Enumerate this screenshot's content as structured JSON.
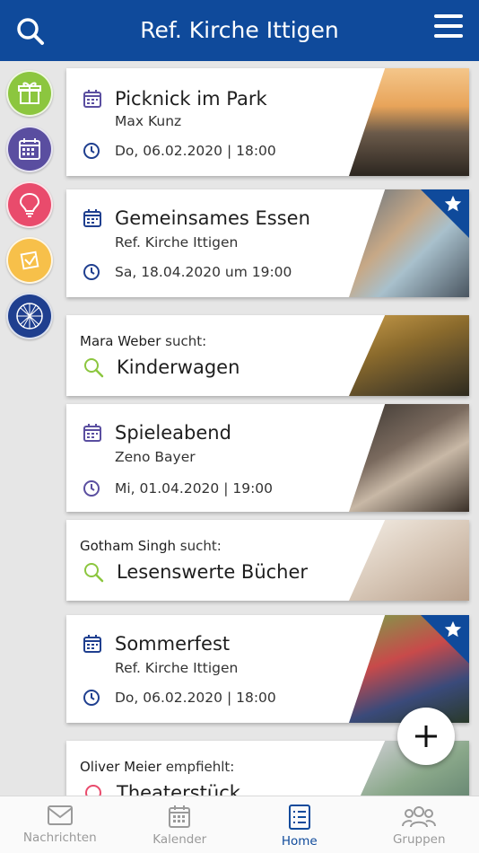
{
  "header": {
    "title": "Ref. Kirche Ittigen",
    "search_icon": "search-icon",
    "menu_icon": "hamburger-menu-icon"
  },
  "rail": [
    {
      "icon": "gift-icon",
      "color": "#8cc63f"
    },
    {
      "icon": "calendar-icon",
      "color": "#5a4ea0"
    },
    {
      "icon": "lightbulb-icon",
      "color": "#e94b6c"
    },
    {
      "icon": "notes-icon",
      "color": "#f7c04a"
    },
    {
      "icon": "network-globe-icon",
      "color": "#1f3f8f"
    }
  ],
  "cards": [
    {
      "type": "event",
      "title": "Picknick im Park",
      "subtitle": "Max Kunz",
      "datetime": "Do, 06.02.2020 | 18:00",
      "favorite": false
    },
    {
      "type": "event",
      "title": "Gemeinsames Essen",
      "subtitle": "Ref. Kirche Ittigen",
      "datetime": "Sa, 18.04.2020 um 19:00",
      "favorite": true
    },
    {
      "type": "search",
      "person": "Mara Weber",
      "verb": "sucht:",
      "title": "Kinderwagen"
    },
    {
      "type": "event",
      "title": "Spieleabend",
      "subtitle": "Zeno Bayer",
      "datetime": "Mi, 01.04.2020 | 19:00",
      "favorite": false
    },
    {
      "type": "search",
      "person": "Gotham Singh",
      "verb": "sucht:",
      "title": "Lesenswerte Bücher"
    },
    {
      "type": "event",
      "title": "Sommerfest",
      "subtitle": "Ref. Kirche Ittigen",
      "datetime": "Do, 06.02.2020 | 18:00",
      "favorite": true
    },
    {
      "type": "recommend",
      "person": "Oliver Meier",
      "verb": "empfiehlt:",
      "title": "Theaterstück"
    }
  ],
  "fab": {
    "icon": "plus-icon"
  },
  "tabs": [
    {
      "label": "Nachrichten",
      "icon": "envelope-icon",
      "active": false
    },
    {
      "label": "Kalender",
      "icon": "calendar-icon",
      "active": false
    },
    {
      "label": "Home",
      "icon": "list-icon",
      "active": true
    },
    {
      "label": "Gruppen",
      "icon": "group-icon",
      "active": false
    }
  ],
  "colors": {
    "brand": "#0f4a9b",
    "event_icon": "#5a4ea0",
    "time_icon": "#1f3f8f",
    "search_icon": "#8cc63f",
    "recommend_icon": "#e94b6c"
  }
}
